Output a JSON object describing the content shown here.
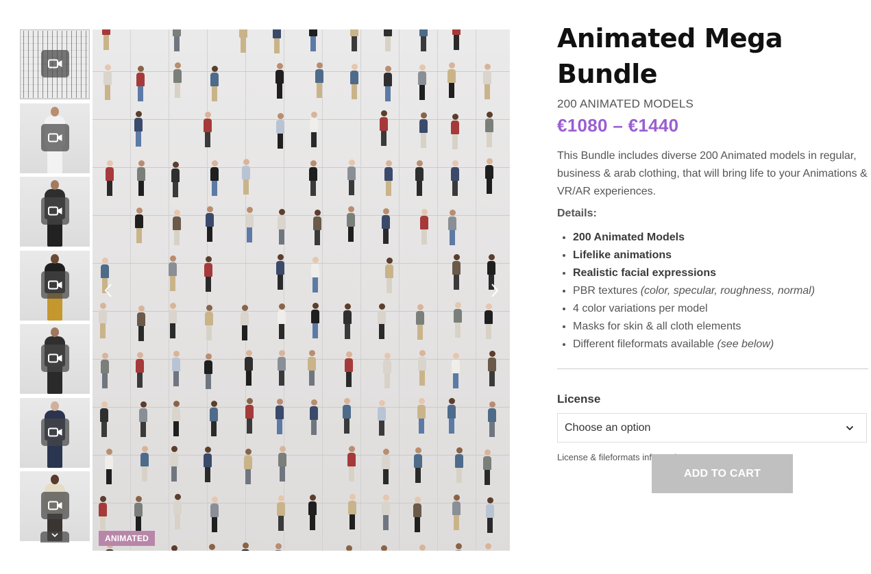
{
  "product": {
    "title": "Animated Mega Bundle",
    "subtitle": "200 ANIMATED MODELS",
    "price": "€1080 – €1440",
    "description": "This Bundle includes diverse 200 Animated models in regular, business & arab clothing, that will bring life to your Animations & VR/AR experiences.",
    "details_label": "Details:",
    "features": [
      {
        "bold": "200 Animated Models",
        "text": "",
        "italic": ""
      },
      {
        "bold": "Lifelike animations",
        "text": "",
        "italic": ""
      },
      {
        "bold": "Realistic facial expressions",
        "text": "",
        "italic": ""
      },
      {
        "bold": "",
        "text": "PBR textures ",
        "italic": "(color, specular, roughness, normal)"
      },
      {
        "bold": "",
        "text": "4 color variations per model",
        "italic": ""
      },
      {
        "bold": "",
        "text": "Masks for skin & all cloth elements",
        "italic": ""
      },
      {
        "bold": "",
        "text": "Different fileformats available ",
        "italic": "(see below)"
      }
    ],
    "license_label": "License",
    "license_select": "Choose an option",
    "license_info_link": "License & fileformats information",
    "add_to_cart": "ADD TO CART"
  },
  "gallery": {
    "badge": "ANIMATED",
    "thumbnail_icon": "video-camera-icon",
    "thumbnails": [
      {
        "kind": "mosaic"
      },
      {
        "kind": "figure",
        "top_color": "#f2f2f2",
        "legs_color": "#f2f2f2",
        "head_color": "#b98d6f"
      },
      {
        "kind": "figure",
        "top_color": "#2e2e2e",
        "legs_color": "#222222",
        "head_color": "#a57b5f"
      },
      {
        "kind": "figure",
        "top_color": "#1f1f1f",
        "legs_color": "#c4972f",
        "head_color": "#6b4a35"
      },
      {
        "kind": "figure",
        "top_color": "#2f2f2f",
        "legs_color": "#2a2a2a",
        "head_color": "#a07860"
      },
      {
        "kind": "figure",
        "top_color": "#2b3550",
        "legs_color": "#2a3550",
        "head_color": "#d1b09a"
      },
      {
        "kind": "figure",
        "top_color": "#e5dcc8",
        "legs_color": "#3a3530",
        "head_color": "#5a3a2a"
      }
    ],
    "crowd_colors": [
      "#2f2f2f",
      "#3b4a6b",
      "#8a8f96",
      "#d9d4cc",
      "#6b5a4a",
      "#a63a3a",
      "#c9b48a",
      "#4e6b8a",
      "#1f1f1f",
      "#7a7f7a",
      "#efeeea",
      "#b8c4d4"
    ],
    "legs_colors": [
      "#2a2a2a",
      "#5d7aa6",
      "#3a3a3a",
      "#c9b48a",
      "#6f7680",
      "#1f1f1f",
      "#d8d2c6"
    ],
    "skin_colors": [
      "#d8b49a",
      "#b98d6f",
      "#8a6347",
      "#5c3e2c",
      "#e6c6ae"
    ]
  },
  "icons": {
    "prev": "chevron-left-icon",
    "next": "chevron-right-icon",
    "thumbs_down": "chevron-down-icon",
    "select_caret": "chevron-down-icon"
  }
}
